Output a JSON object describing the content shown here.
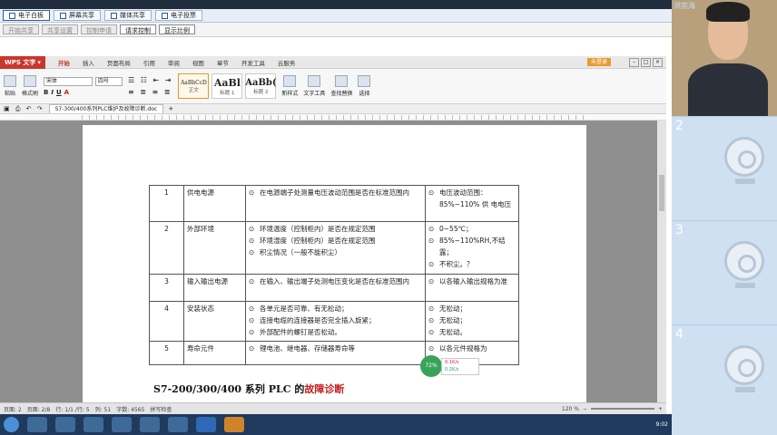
{
  "classroom_tabs": [
    {
      "label": "电子白板",
      "active": true
    },
    {
      "label": "屏幕共享",
      "active": false
    },
    {
      "label": "媒体共享",
      "active": false
    },
    {
      "label": "电子投票",
      "active": false
    }
  ],
  "sub_buttons": [
    {
      "label": "开始共享",
      "enabled": false
    },
    {
      "label": "共享设置",
      "enabled": false
    },
    {
      "label": "控制申请",
      "enabled": false
    },
    {
      "label": "请求控制",
      "enabled": true
    },
    {
      "label": "显示比例",
      "enabled": true
    }
  ],
  "wps": {
    "app_label": "WPS 文字",
    "menus": [
      "开始",
      "插入",
      "页面布局",
      "引用",
      "审阅",
      "视图",
      "章节",
      "开发工具",
      "云服务"
    ],
    "account": "未登录",
    "ribbon": {
      "paste": "粘贴",
      "format_painter": "格式刷",
      "font_name": "宋体",
      "font_size": "四号",
      "format_buttons": [
        "B",
        "I",
        "U",
        "A"
      ],
      "styles": [
        {
          "preview": "AaBbCcD",
          "name": "正文"
        },
        {
          "preview": "AaBl",
          "name": "标题 1"
        },
        {
          "preview": "AaBb(",
          "name": "标题 2"
        }
      ],
      "new_style": "新样式",
      "text_tools": "文字工具",
      "find_replace": "查找替换",
      "select": "选择"
    },
    "doc_tab": "S7-300/400系列PLC维护及故障诊断.doc",
    "table_rows": [
      {
        "no": "1",
        "item": "供电电源",
        "content": [
          "在电源端子处测量电压波动范围是否在标准范围内"
        ],
        "standard": [
          "电压波动范围：85%~110% 供 电电压"
        ]
      },
      {
        "no": "2",
        "item": "外部环境",
        "content": [
          "环境温度（控制柜内）是否在规定范围",
          "环境湿度（控制柜内）是否在规定范围",
          "积尘情况（一般不能积尘）"
        ],
        "standard": [
          "0~55℃；",
          "85%~110%RH,不结露；",
          "不积尘。？"
        ]
      },
      {
        "no": "3",
        "item": "输入输出电源",
        "content": [
          "在输入、输出端子处测电压变化是否在标准范围内"
        ],
        "standard": [
          "以各输入输出规格为准"
        ]
      },
      {
        "no": "4",
        "item": "安装状态",
        "content": [
          "各单元是否可靠、有无松动；",
          "连接电缆的连接器是否完全插入旋紧；",
          "外部配件的螺钉是否松动。"
        ],
        "standard": [
          "无松动；",
          "无松动；",
          "无松动。"
        ]
      },
      {
        "no": "5",
        "item": "寿命元件",
        "content": [
          "锂电池、继电器、存储器寿命等"
        ],
        "standard": [
          "以各元件规格为"
        ]
      }
    ],
    "heading_plain": "S7-200/300/400 系列 PLC 的",
    "heading_red": "故障诊断",
    "status": {
      "page": "页面: 2",
      "pages": "页面: 2/8",
      "line": "行: 1/1 /行: 5",
      "col": "列: 51",
      "words": "字数: 4565",
      "mode": "拼写检查",
      "zoom": "120 %"
    }
  },
  "net_badge": {
    "percent": "72%",
    "up": "0.1K/s",
    "down": "0.2K/s"
  },
  "side_panel": {
    "presenter_name": "洪宗海",
    "slots": [
      "2",
      "3",
      "4"
    ]
  },
  "taskbar": {
    "time": "9:02"
  }
}
